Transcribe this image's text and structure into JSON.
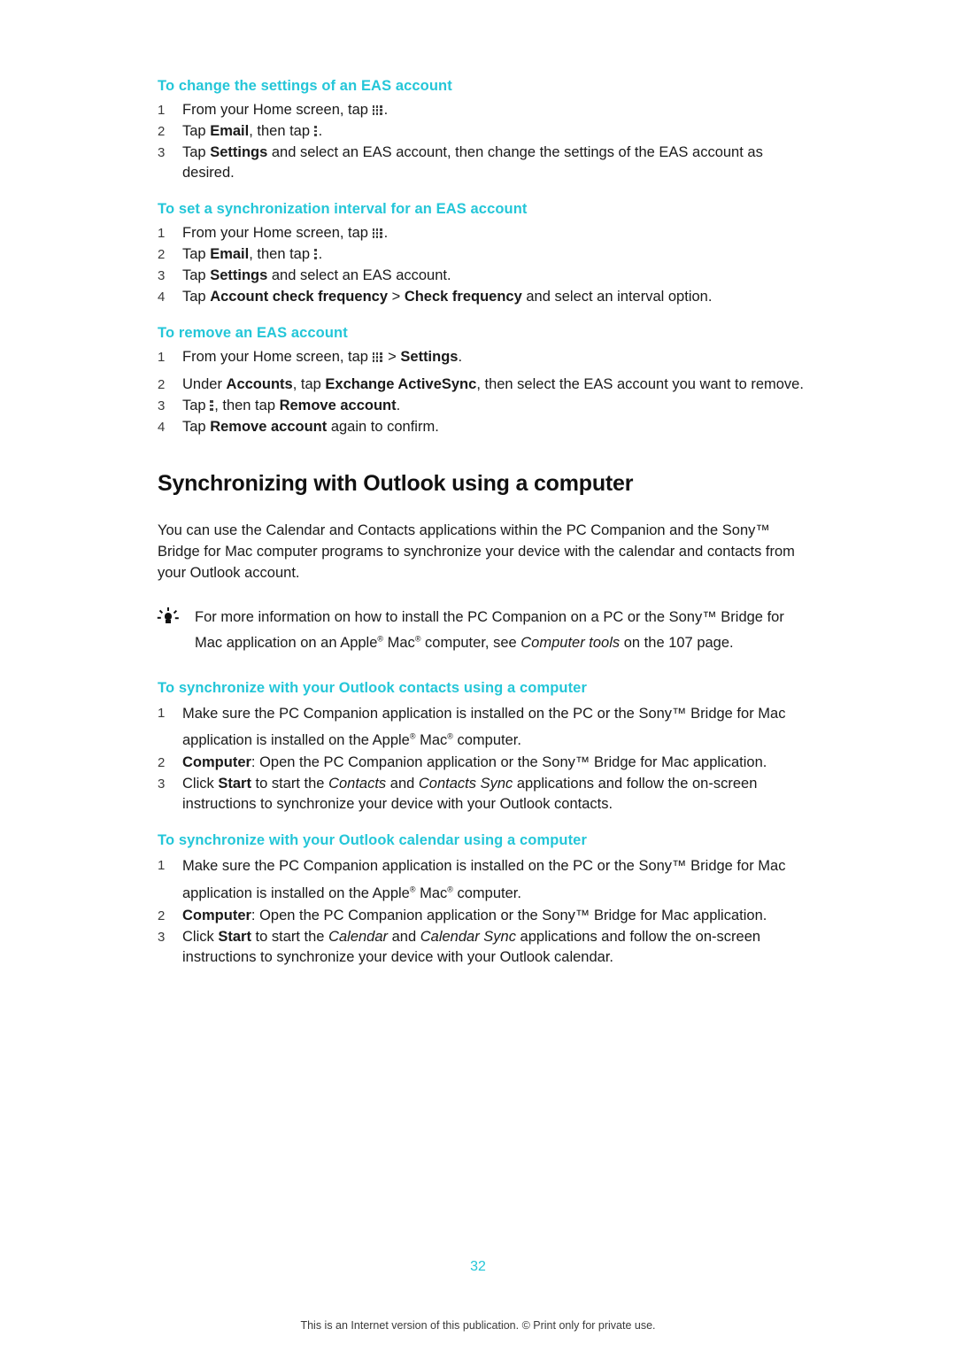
{
  "page": {
    "number": "32",
    "footer": "This is an Internet version of this publication. © Print only for private use."
  },
  "sections": [
    {
      "heading": "To change the settings of an EAS account",
      "steps": [
        {
          "num": "1",
          "pre": "From your Home screen, tap ",
          "icon": "grid-icon",
          "post": "."
        },
        {
          "num": "2",
          "pre": "Tap ",
          "bold": "Email",
          "mid": ", then tap ",
          "icon": "dots-icon",
          "post": "."
        },
        {
          "num": "3",
          "pre": "Tap ",
          "bold": "Settings",
          "mid": " and select an EAS account, then change the settings of the EAS account as desired.",
          "post": ""
        }
      ]
    },
    {
      "heading": "To set a synchronization interval for an EAS account",
      "steps": [
        {
          "num": "1",
          "pre": "From your Home screen, tap ",
          "icon": "grid-icon",
          "post": "."
        },
        {
          "num": "2",
          "pre": "Tap ",
          "bold": "Email",
          "mid": ", then tap ",
          "icon": "dots-icon",
          "post": "."
        },
        {
          "num": "3",
          "pre": "Tap ",
          "bold": "Settings",
          "mid": " and select an EAS account.",
          "post": ""
        },
        {
          "num": "4",
          "pre": "Tap ",
          "bold": "Account check frequency",
          "mid": " > ",
          "bold2": "Check frequency",
          "post": " and select an interval option."
        }
      ]
    },
    {
      "heading": "To remove an EAS account",
      "steps": [
        {
          "num": "1",
          "pre": "From your Home screen, tap ",
          "icon": "grid-icon",
          "mid": " > ",
          "bold": "Settings",
          "post": "."
        },
        {
          "num": "2",
          "pre": "Under ",
          "bold": "Accounts",
          "mid": ", tap ",
          "bold2": "Exchange ActiveSync",
          "post": ", then select the EAS account you want to remove."
        },
        {
          "num": "3",
          "pre": "Tap ",
          "icon": "dots-icon",
          "mid": ", then tap ",
          "bold": "Remove account",
          "post": "."
        },
        {
          "num": "4",
          "pre": "Tap ",
          "bold": "Remove account",
          "post": " again to confirm."
        }
      ]
    }
  ],
  "chapter": {
    "title": "Synchronizing with Outlook using a computer",
    "intro": "You can use the Calendar and Contacts applications within the PC Companion and the Sony™ Bridge for Mac computer programs to synchronize your device with the calendar and contacts from your Outlook account.",
    "note": {
      "part1": "For more information on how to install the PC Companion on a PC or the Sony™ Bridge for Mac application on an Apple",
      "reg1": "®",
      "part2": " Mac",
      "reg2": "®",
      "part3": " computer, see ",
      "italic": "Computer tools",
      "part4": " on the 107 page."
    }
  },
  "sections2": [
    {
      "heading": "To synchronize with your Outlook contacts using a computer",
      "steps": [
        {
          "num": "1",
          "line1": "Make sure the PC Companion application is installed on the PC or the Sony™",
          "line2a": "Bridge for Mac application is installed on the Apple",
          "reg1": "®",
          "line2b": " Mac",
          "reg2": "®",
          "line2c": " computer."
        },
        {
          "num": "2",
          "bold": "Computer",
          "post": ": Open the PC Companion application or the Sony™ Bridge for Mac application."
        },
        {
          "num": "3",
          "pre": "Click ",
          "bold": "Start",
          "mid": " to start the ",
          "italic1": "Contacts",
          "mid2": " and ",
          "italic2": "Contacts Sync",
          "post": " applications and follow the on-screen instructions to synchronize your device with your Outlook contacts."
        }
      ]
    },
    {
      "heading": "To synchronize with your Outlook calendar using a computer",
      "steps": [
        {
          "num": "1",
          "line1": "Make sure the PC Companion application is installed on the PC or the Sony™",
          "line2a": "Bridge for Mac application is installed on the Apple",
          "reg1": "®",
          "line2b": " Mac",
          "reg2": "®",
          "line2c": " computer."
        },
        {
          "num": "2",
          "bold": "Computer",
          "post": ": Open the PC Companion application or the Sony™ Bridge for Mac application."
        },
        {
          "num": "3",
          "pre": "Click ",
          "bold": "Start",
          "mid": " to start the ",
          "italic1": "Calendar",
          "mid2": " and ",
          "italic2": "Calendar Sync",
          "post": " applications and follow the on-screen instructions to synchronize your device with your Outlook calendar."
        }
      ]
    }
  ],
  "colors": {
    "heading": "#24c6d8",
    "text": "#1a1a1a"
  }
}
